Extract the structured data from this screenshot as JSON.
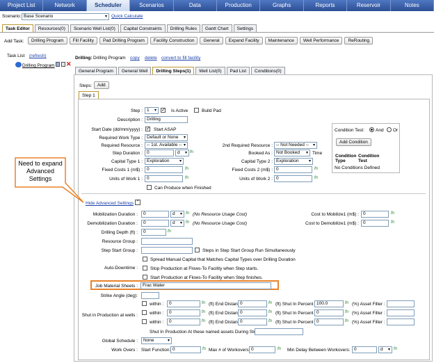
{
  "nav": [
    "Project List",
    "Network",
    "Scheduler",
    "Scenarios",
    "Data",
    "Production",
    "Graphs",
    "Reports",
    "Reservoir",
    "Notes"
  ],
  "scenario": {
    "label": "Scenario:",
    "value": "Base Scenario",
    "quick_calc": "Quick Calculate"
  },
  "main_tabs": [
    "Task Editor",
    "Resources(0)",
    "Scenario Well List(0)",
    "Capital Constraints",
    "Drilling Rules",
    "Gantt Chart",
    "Settings"
  ],
  "add_task": {
    "label": "Add Task:",
    "buttons": [
      "Drilling Program",
      "Fill Facility",
      "Pad Drilling Program",
      "Facility Construction",
      "General",
      "Expand Facility",
      "Maintenance",
      "Well Performance",
      "ReRouting"
    ]
  },
  "task_list": {
    "label": "Task List",
    "refresh": "(refresh)",
    "item": "Drilling Program"
  },
  "drilling_header": {
    "label": "Drilling:",
    "name": "Drilling Program",
    "copy": "copy",
    "delete": "delete",
    "convert": "convert to fill facility"
  },
  "sub_tabs": [
    "General Program",
    "General Well",
    "Drilling Steps(1)",
    "Well List(0)",
    "Pad List",
    "Conditions(0)"
  ],
  "steps": {
    "label": "Steps:",
    "add": "Add",
    "step_tab": "Step 1"
  },
  "callout": "Need to expand Advanced Settings",
  "form": {
    "step_label": "Step :",
    "step_value": "1",
    "is_active": "Is Active",
    "build_pad": "Build Pad",
    "description_label": "Description :",
    "description_value": "Drilling",
    "start_date_label": "Start Date (dd/mm/yyyy) :",
    "start_asap": "Start ASAP",
    "req_work_type_label": "Required Work Type :",
    "req_work_type_value": "Default or None",
    "req_resource_label": "Required Resource :",
    "req_resource_value": "-- 1st. Available --",
    "req_resource2_label": "2nd Required Resource :",
    "req_resource2_value": "-- Not Needed --",
    "step_duration_label": "Step Duration :",
    "step_duration_value": "0",
    "step_duration_unit": "d",
    "booked_as_label": "Booked As :",
    "booked_as_value": "Not Booked",
    "time": "Time",
    "cap_type1_label": "Capital Type 1 :",
    "cap_type1_value": "Exploration",
    "cap_type2_label": "Capital Type 2 :",
    "cap_type2_value": "Exploration",
    "fixed1_label": "Fixed Costs 1 (m$) :",
    "fixed1_value": "0",
    "fixed2_label": "Fixed Costs 2 (m$) :",
    "fixed2_value": "0",
    "units1_label": "Units of Work 1 :",
    "units1_value": "0",
    "units2_label": "Units of Work 2 :",
    "units2_value": "0",
    "can_produce": "Can Produce when Finished",
    "fn": "fn"
  },
  "condition": {
    "test_label": "Condition Test:",
    "and": "And",
    "or": "Or",
    "add": "Add Condition",
    "col1a": "Condition",
    "col1b": "Type",
    "col2a": "Condition",
    "col2b": "Test",
    "none": "No Conditions Defined"
  },
  "advanced": {
    "hide": "Hide Advanced Settings",
    "mob_label": "Mobilization Duration :",
    "mob_value": "0",
    "mob_unit": "d",
    "mob_note": "(No Resource Usage Cost)",
    "demob_label": "Demobilization Duration :",
    "demob_value": "0",
    "demob_unit": "d",
    "demob_note": "(No Resource Usage Cost)",
    "cost_mob_label": "Cost to Mobilize1 (m$) :",
    "cost_mob_value": "0",
    "cost_demob_label": "Cost to Demobilize1 (m$) :",
    "cost_demob_value": "0",
    "depth_label": "Drilling Depth (ft) :",
    "depth_value": "0",
    "res_group_label": "Resource Group :",
    "start_group_label": "Step Start Group :",
    "start_group_note": "Steps in Step Start Group Run Simultaneously",
    "spread": "Spread Manual Capital that Matches Capital Types over Drilling Duration",
    "auto_down_label": "Auto-Downtime :",
    "stop_prod": "Stop Production at Flows-To Facility when Step starts.",
    "start_prod": "Start Production at Flows-To Facility when Step finishes.",
    "jms_label": "Job Material Sheets :",
    "jms_value": "Frac Water",
    "strike_label": "Strike Angle (deg):",
    "shut_label": "Shut in Production at wells :",
    "within": "within :",
    "ft": "(ft)",
    "end_dist": "End Distance :",
    "shut_pct": "Shut In Percent :",
    "pct": "(%)",
    "asset_filter": "Asset Filter :",
    "rows": [
      {
        "w": "0",
        "e": "0",
        "p": "100.0"
      },
      {
        "w": "0",
        "e": "0",
        "p": "0"
      },
      {
        "w": "0",
        "e": "0",
        "p": "0"
      }
    ],
    "shut_named": "Shut In Production At these named assets During Step:",
    "global_label": "Global Schedule :",
    "global_value": "None",
    "work_overs_label": "Work Overs :",
    "start_fn_label": "Start Function:",
    "start_fn_value": "0",
    "max_wo_label": "Max # of Workovers:",
    "max_wo_value": "0",
    "min_delay_label": "Min Delay Between Workovers:",
    "min_delay_value": "0",
    "min_delay_unit": "d"
  },
  "colors": {
    "nav_bg": "#2c4f95",
    "callout_border": "#e8822a",
    "callout_fill": "#ffffff",
    "highlight": "#e8822a"
  }
}
